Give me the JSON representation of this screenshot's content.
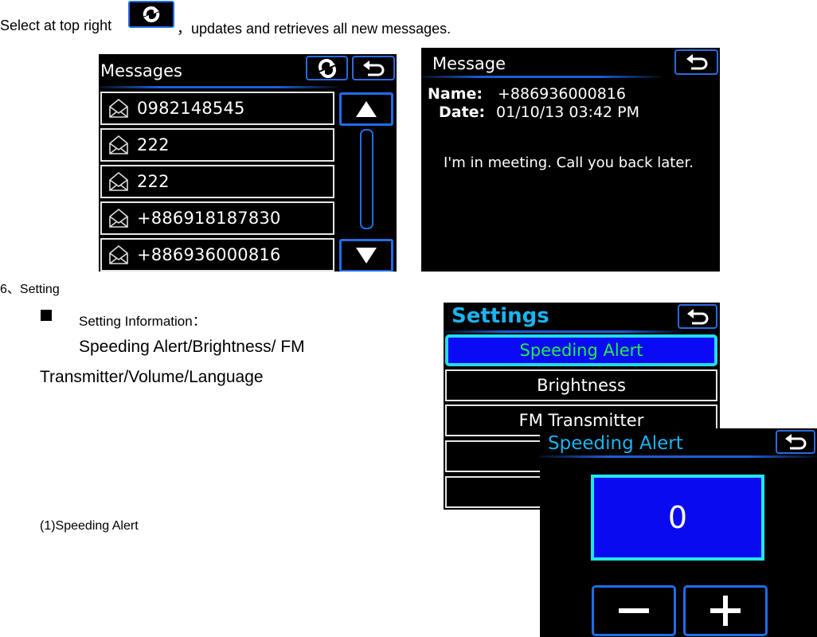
{
  "intro": {
    "before_icon": "Select at top right",
    "icon": "refresh-icon",
    "after_icon": "，updates and retrieves all new messages."
  },
  "messages_screen": {
    "title": "Messages",
    "header_buttons": [
      {
        "icon": "refresh-icon",
        "label": "Refresh"
      },
      {
        "icon": "back-arrow-icon",
        "label": "Back"
      }
    ],
    "items": [
      {
        "icon": "envelope-open-icon",
        "number": "0982148545"
      },
      {
        "icon": "envelope-open-icon",
        "number": "222"
      },
      {
        "icon": "envelope-open-icon",
        "number": "222"
      },
      {
        "icon": "envelope-open-icon",
        "number": "+886918187830"
      },
      {
        "icon": "envelope-open-icon",
        "number": "+886936000816"
      }
    ],
    "scroll_up_icon": "triangle-up-icon",
    "scroll_down_icon": "triangle-down-icon"
  },
  "message_screen": {
    "title": "Message",
    "back_icon": "back-arrow-icon",
    "name_label": "Name:",
    "name_value": "+886936000816",
    "date_label": "Date:",
    "date_value": "01/10/13 03:42 PM",
    "body": "I'm in meeting. Call you back later."
  },
  "section": {
    "heading": "6、Setting",
    "bullet_title": "Setting Information：",
    "description_line1": "Speeding Alert/Brightness/ FM",
    "description_line2": "Transmitter/Volume/Language",
    "subheading": "(1)Speeding Alert"
  },
  "settings_screen": {
    "title": "Settings",
    "back_icon": "back-arrow-icon",
    "items": [
      {
        "label": "Speeding Alert",
        "active": true
      },
      {
        "label": "Brightness",
        "active": false
      },
      {
        "label": "FM Transmitter",
        "active": false
      },
      {
        "label": "",
        "active": false
      },
      {
        "label": "",
        "active": false
      }
    ]
  },
  "speeding_screen": {
    "title": "Speeding Alert",
    "back_icon": "back-arrow-icon",
    "value": "0",
    "minus_icon": "minus-icon",
    "plus_icon": "plus-icon"
  },
  "colors": {
    "accent_blue": "#1e6ee8",
    "title_cyan": "#1ab4f0",
    "active_fill": "#0a0af5",
    "active_border": "#22dde8",
    "active_text": "#22ee44"
  }
}
